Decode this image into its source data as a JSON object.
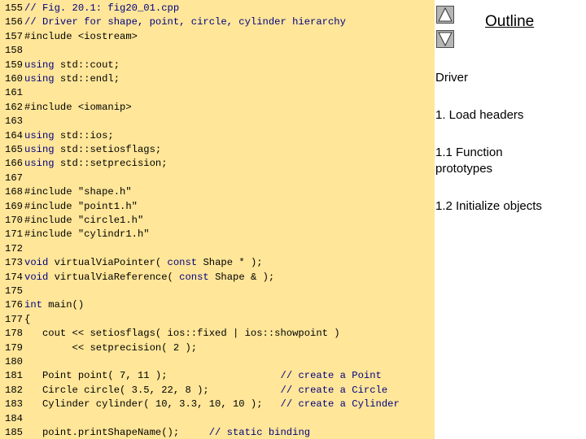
{
  "code": {
    "lines": [
      {
        "num": "155",
        "segments": [
          {
            "t": "// Fig. 20.1: fig20_01.cpp",
            "c": "cm"
          }
        ]
      },
      {
        "num": "156",
        "segments": [
          {
            "t": "// Driver for shape, point, circle, cylinder hierarchy",
            "c": "cm"
          }
        ]
      },
      {
        "num": "157",
        "segments": [
          {
            "t": "#include <iostream>",
            "c": ""
          }
        ]
      },
      {
        "num": "158",
        "segments": []
      },
      {
        "num": "159",
        "segments": [
          {
            "t": "using",
            "c": "kw"
          },
          {
            "t": " std::cout;",
            "c": ""
          }
        ]
      },
      {
        "num": "160",
        "segments": [
          {
            "t": "using",
            "c": "kw"
          },
          {
            "t": " std::endl;",
            "c": ""
          }
        ]
      },
      {
        "num": "161",
        "segments": []
      },
      {
        "num": "162",
        "segments": [
          {
            "t": "#include <iomanip>",
            "c": ""
          }
        ]
      },
      {
        "num": "163",
        "segments": []
      },
      {
        "num": "164",
        "segments": [
          {
            "t": "using",
            "c": "kw"
          },
          {
            "t": " std::ios;",
            "c": ""
          }
        ]
      },
      {
        "num": "165",
        "segments": [
          {
            "t": "using",
            "c": "kw"
          },
          {
            "t": " std::setiosflags;",
            "c": ""
          }
        ]
      },
      {
        "num": "166",
        "segments": [
          {
            "t": "using",
            "c": "kw"
          },
          {
            "t": " std::setprecision;",
            "c": ""
          }
        ]
      },
      {
        "num": "167",
        "segments": []
      },
      {
        "num": "168",
        "segments": [
          {
            "t": "#include \"shape.h\"",
            "c": ""
          }
        ]
      },
      {
        "num": "169",
        "segments": [
          {
            "t": "#include \"point1.h\"",
            "c": ""
          }
        ]
      },
      {
        "num": "170",
        "segments": [
          {
            "t": "#include \"circle1.h\"",
            "c": ""
          }
        ]
      },
      {
        "num": "171",
        "segments": [
          {
            "t": "#include \"cylindr1.h\"",
            "c": ""
          }
        ]
      },
      {
        "num": "172",
        "segments": []
      },
      {
        "num": "173",
        "segments": [
          {
            "t": "void",
            "c": "kw"
          },
          {
            "t": " virtualViaPointer( ",
            "c": ""
          },
          {
            "t": "const",
            "c": "kw"
          },
          {
            "t": " Shape * );",
            "c": ""
          }
        ]
      },
      {
        "num": "174",
        "segments": [
          {
            "t": "void",
            "c": "kw"
          },
          {
            "t": " virtualViaReference( ",
            "c": ""
          },
          {
            "t": "const",
            "c": "kw"
          },
          {
            "t": " Shape & );",
            "c": ""
          }
        ]
      },
      {
        "num": "175",
        "segments": []
      },
      {
        "num": "176",
        "segments": [
          {
            "t": "int",
            "c": "kw"
          },
          {
            "t": " main()",
            "c": ""
          }
        ]
      },
      {
        "num": "177",
        "segments": [
          {
            "t": "{",
            "c": ""
          }
        ]
      },
      {
        "num": "178",
        "segments": [
          {
            "t": "   cout << setiosflags( ios::fixed | ios::showpoint )",
            "c": ""
          }
        ]
      },
      {
        "num": "179",
        "segments": [
          {
            "t": "        << setprecision( 2 );",
            "c": ""
          }
        ]
      },
      {
        "num": "180",
        "segments": []
      },
      {
        "num": "181",
        "segments": [
          {
            "t": "   Point point( 7, 11 );                   ",
            "c": ""
          },
          {
            "t": "// create a Point",
            "c": "cm"
          }
        ]
      },
      {
        "num": "182",
        "segments": [
          {
            "t": "   Circle circle( 3.5, 22, 8 );            ",
            "c": ""
          },
          {
            "t": "// create a Circle",
            "c": "cm"
          }
        ]
      },
      {
        "num": "183",
        "segments": [
          {
            "t": "   Cylinder cylinder( 10, 3.3, 10, 10 );   ",
            "c": ""
          },
          {
            "t": "// create a Cylinder",
            "c": "cm"
          }
        ]
      },
      {
        "num": "184",
        "segments": []
      },
      {
        "num": "185",
        "segments": [
          {
            "t": "   point.printShapeName();     ",
            "c": ""
          },
          {
            "t": "// static binding",
            "c": "cm"
          }
        ]
      }
    ]
  },
  "sidebar": {
    "title": "Outline",
    "items": [
      {
        "label": "Driver"
      },
      {
        "label": "1. Load headers"
      },
      {
        "label": "1.1 Function prototypes"
      },
      {
        "label": "1.2 Initialize objects"
      }
    ],
    "up_icon": "triangle-up-icon",
    "down_icon": "triangle-down-icon"
  },
  "colors": {
    "code_background": "#ffe699",
    "keyword": "#000080",
    "button_face": "#b5b5b5"
  }
}
